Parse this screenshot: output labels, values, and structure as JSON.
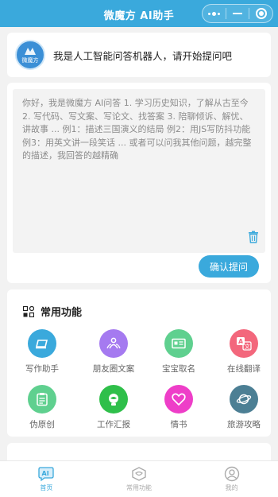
{
  "header": {
    "title": "微魔方 AI助手"
  },
  "welcome": {
    "avatar_text": "微魔方",
    "message": "我是人工智能问答机器人，请开始提问吧"
  },
  "question": {
    "placeholder": "你好，我是微魔方 AI问答 1. 学习历史知识，了解从古至今 2. 写代码、写文案、写论文、找答案 3. 陪聊倾诉、解忧、讲故事 ... 例1：描述三国演义的结局 例2：用JS写防抖功能 例3：用英文讲一段笑话 ... 或者可以问我其他问题，越完整的描述，我回答的越精确",
    "submit_label": "确认提问"
  },
  "functions": {
    "title": "常用功能",
    "items": [
      {
        "label": "写作助手",
        "icon": "writing-icon",
        "color": "#3aa9dc"
      },
      {
        "label": "朋友圈文案",
        "icon": "friends-icon",
        "color": "#a57af0"
      },
      {
        "label": "宝宝取名",
        "icon": "id-card-icon",
        "color": "#5fd08f"
      },
      {
        "label": "在线翻译",
        "icon": "translate-icon",
        "color": "#f3677c"
      },
      {
        "label": "伪原创",
        "icon": "clipboard-icon",
        "color": "#5fd08f"
      },
      {
        "label": "工作汇报",
        "icon": "report-icon",
        "color": "#2fbf4a"
      },
      {
        "label": "情书",
        "icon": "heart-icon",
        "color": "#ee3ec8"
      },
      {
        "label": "旅游攻略",
        "icon": "planet-icon",
        "color": "#4c7f94"
      }
    ]
  },
  "tabbar": {
    "tabs": [
      {
        "label": "首页",
        "icon": "ai-icon",
        "active": true
      },
      {
        "label": "常用功能",
        "icon": "hexagon-icon",
        "active": false
      },
      {
        "label": "我的",
        "icon": "user-icon",
        "active": false
      }
    ]
  },
  "colors": {
    "primary": "#3aa9dc",
    "background": "#f2f2f2"
  }
}
